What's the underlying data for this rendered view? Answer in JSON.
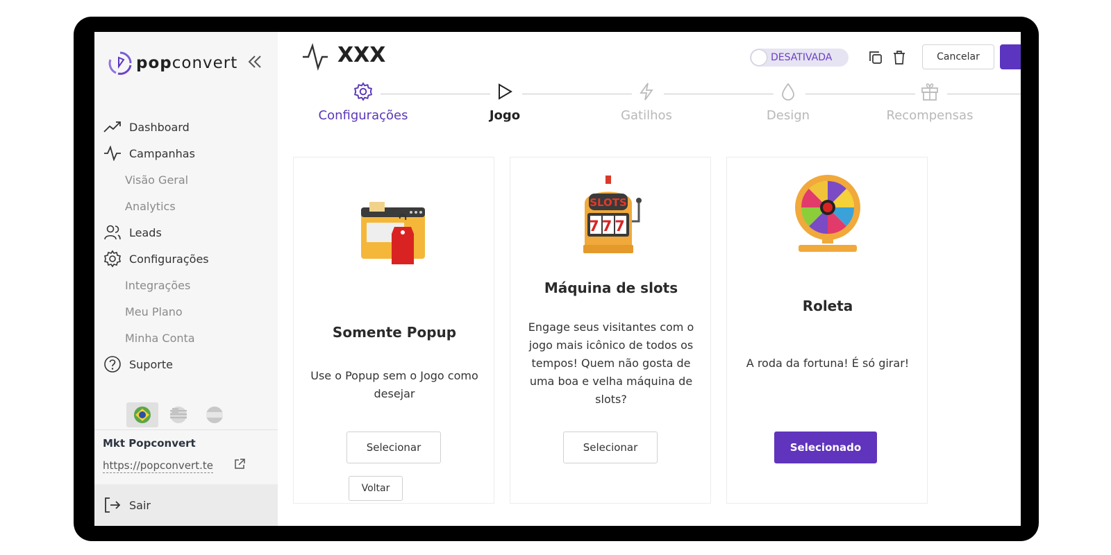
{
  "app": {
    "logo_bold": "pop",
    "logo_rest": "convert"
  },
  "sidebar": {
    "nav": [
      {
        "label": "Dashboard",
        "icon": "trending-up-icon"
      },
      {
        "label": "Campanhas",
        "icon": "activity-icon"
      },
      {
        "label": "Visão Geral",
        "sub": true
      },
      {
        "label": "Analytics",
        "sub": true
      },
      {
        "label": "Leads",
        "icon": "users-icon"
      },
      {
        "label": "Configurações",
        "icon": "gear-icon"
      },
      {
        "label": "Integrações",
        "sub": true
      },
      {
        "label": "Meu Plano",
        "sub": true
      },
      {
        "label": "Minha Conta",
        "sub": true
      },
      {
        "label": "Suporte",
        "icon": "help-circle-icon"
      }
    ],
    "account_name": "Mkt Popconvert",
    "account_url": "https://popconvert.te",
    "logout_label": "Sair"
  },
  "header": {
    "title": "XXX",
    "status_label": "DESATIVADA",
    "cancel_label": "Cancelar"
  },
  "stepper": {
    "steps": [
      {
        "label": "Configurações",
        "state": "done"
      },
      {
        "label": "Jogo",
        "state": "current"
      },
      {
        "label": "Gatilhos",
        "state": "todo"
      },
      {
        "label": "Design",
        "state": "todo"
      },
      {
        "label": "Recompensas",
        "state": "todo"
      }
    ]
  },
  "cards": [
    {
      "title": "Somente Popup",
      "description": "Use o Popup sem o Jogo como desejar",
      "button": "Selecionar",
      "selected": false
    },
    {
      "title": "Máquina de slots",
      "description": "Engage seus visitantes com o jogo mais icônico de todos os tempos! Quem não gosta de uma boa e velha máquina de slots?",
      "button": "Selecionar",
      "selected": false,
      "art_text_top": "SLOTS",
      "art_text_reels": "777"
    },
    {
      "title": "Roleta",
      "description": "A roda da fortuna! É só girar!",
      "button": "Selecionado",
      "selected": true
    }
  ],
  "footer": {
    "back_label": "Voltar"
  },
  "colors": {
    "accent": "#5b35c0",
    "status_bg": "#e6e4f2"
  }
}
